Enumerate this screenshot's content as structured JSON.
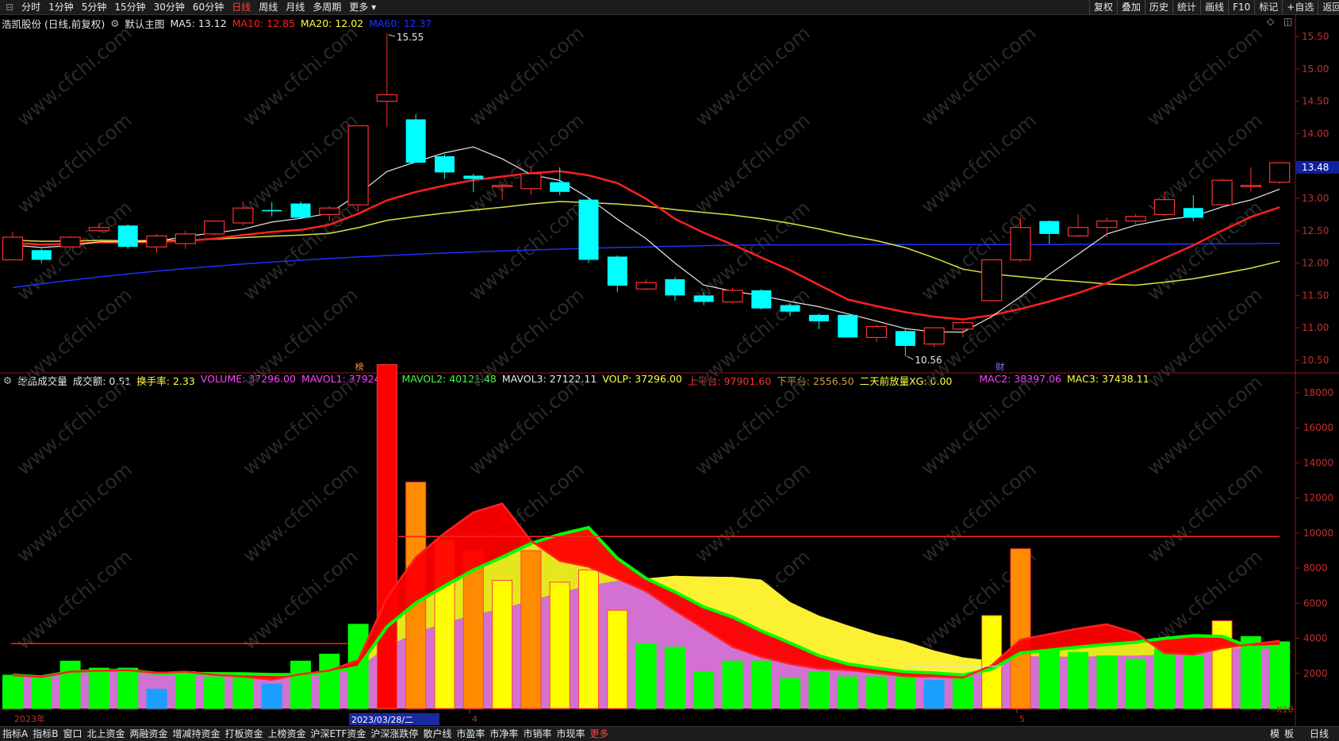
{
  "topbar": {
    "periods": [
      {
        "label": "分时",
        "active": false
      },
      {
        "label": "1分钟",
        "active": false
      },
      {
        "label": "5分钟",
        "active": false
      },
      {
        "label": "15分钟",
        "active": false
      },
      {
        "label": "30分钟",
        "active": false
      },
      {
        "label": "60分钟",
        "active": false
      },
      {
        "label": "日线",
        "active": true
      },
      {
        "label": "周线",
        "active": false
      },
      {
        "label": "月线",
        "active": false
      },
      {
        "label": "多周期",
        "active": false
      },
      {
        "label": "更多 ▾",
        "active": false
      }
    ],
    "right_buttons": [
      "复权",
      "叠加",
      "历史",
      "统计",
      "画线",
      "F10",
      "+自选",
      "返回"
    ],
    "mark_label": "标记"
  },
  "main_chart": {
    "stock_label": "浩凯股份 (日线,前复权)",
    "template_label": "默认主图",
    "ma": [
      {
        "text": "MA5: 13.12",
        "color": "#e8e8e8"
      },
      {
        "text": "MA10: 12.85",
        "color": "#ff2020"
      },
      {
        "text": "MA20: 12.02",
        "color": "#ffff40"
      },
      {
        "text": "MA60: 12.37",
        "color": "#2030ff"
      }
    ],
    "high_label": "15.55",
    "low_label": "10.56",
    "marker_bang": "榜",
    "marker_cai": "财",
    "price_axis": [
      "15.50",
      "15.00",
      "14.50",
      "14.00",
      "13.50",
      "13.00",
      "12.50",
      "12.00",
      "11.50",
      "11.00",
      "10.50"
    ],
    "current_price": "13.48"
  },
  "volume_chart": {
    "title": "绝品成交量",
    "items": [
      {
        "text": "成交额: 0.51",
        "color": "#e8e8e8"
      },
      {
        "text": "换手率: 2.33",
        "color": "#ffff40"
      },
      {
        "text": "VOLUME: 37296.00",
        "color": "#ff40ff"
      },
      {
        "text": "MAVOL1: 37924.60",
        "color": "#ff40ff"
      },
      {
        "text": "MAVOL2: 40121.48",
        "color": "#40ff40"
      },
      {
        "text": "MAVOL3: 27122.11",
        "color": "#e8e8e8"
      },
      {
        "text": "VOLP: 37296.00",
        "color": "#ffff40"
      },
      {
        "text": "上平台: 97901.60",
        "color": "#ff3030"
      },
      {
        "text": "下平台: 2556.50",
        "color": "#c8a040"
      },
      {
        "text": "二天前放量XG: 0.00",
        "color": "#ffff40"
      },
      {
        "text": "MAC2: 38397.06",
        "color": "#ff40ff"
      },
      {
        "text": "MAC3: 37438.11",
        "color": "#ffff40"
      }
    ],
    "axis": [
      "18000",
      "16000",
      "14000",
      "12000",
      "10000",
      "8000",
      "6000",
      "4000",
      "2000"
    ],
    "unit": "X10"
  },
  "date_axis": {
    "year": "2023年",
    "cursor_date": "2023/03/28/二",
    "m4": "4",
    "m5": "5"
  },
  "bottombar": {
    "tabs": [
      {
        "label": "指标A",
        "active": false
      },
      {
        "label": "指标B",
        "active": false
      },
      {
        "label": "窗口",
        "active": false
      },
      {
        "label": "北上资金",
        "active": false
      },
      {
        "label": "两融资金",
        "active": false
      },
      {
        "label": "增减持资金",
        "active": false
      },
      {
        "label": "打板资金",
        "active": false
      },
      {
        "label": "上榜资金",
        "active": false
      },
      {
        "label": "沪深ETF资金",
        "active": false
      },
      {
        "label": "沪深涨跌停",
        "active": false
      },
      {
        "label": "散户线",
        "active": false
      },
      {
        "label": "市盈率",
        "active": false
      },
      {
        "label": "市净率",
        "active": false
      },
      {
        "label": "市销率",
        "active": false
      },
      {
        "label": "市现率",
        "active": false
      },
      {
        "label": "更多",
        "active": true
      }
    ],
    "right": [
      "模",
      "板",
      "日线"
    ]
  },
  "candles": [
    {
      "o": 12.05,
      "c": 12.4,
      "h": 12.48,
      "l": 12.05
    },
    {
      "o": 12.2,
      "c": 12.05,
      "h": 12.22,
      "l": 12.0
    },
    {
      "o": 12.25,
      "c": 12.4,
      "h": 12.42,
      "l": 12.2
    },
    {
      "o": 12.5,
      "c": 12.55,
      "h": 12.62,
      "l": 12.48
    },
    {
      "o": 12.58,
      "c": 12.25,
      "h": 12.6,
      "l": 12.22
    },
    {
      "o": 12.25,
      "c": 12.42,
      "h": 12.45,
      "l": 12.15
    },
    {
      "o": 12.3,
      "c": 12.45,
      "h": 12.5,
      "l": 12.22
    },
    {
      "o": 12.45,
      "c": 12.65,
      "h": 12.66,
      "l": 12.42
    },
    {
      "o": 12.62,
      "c": 12.85,
      "h": 12.95,
      "l": 12.58
    },
    {
      "o": 12.82,
      "c": 12.8,
      "h": 12.94,
      "l": 12.72
    },
    {
      "o": 12.92,
      "c": 12.7,
      "h": 12.95,
      "l": 12.68
    },
    {
      "o": 12.75,
      "c": 12.85,
      "h": 12.88,
      "l": 12.65
    },
    {
      "o": 12.9,
      "c": 14.12,
      "h": 14.12,
      "l": 12.8
    },
    {
      "o": 14.5,
      "c": 14.6,
      "h": 15.55,
      "l": 14.1
    },
    {
      "o": 14.22,
      "c": 13.55,
      "h": 14.3,
      "l": 13.55
    },
    {
      "o": 13.65,
      "c": 13.4,
      "h": 13.68,
      "l": 13.3
    },
    {
      "o": 13.35,
      "c": 13.3,
      "h": 13.38,
      "l": 13.1
    },
    {
      "o": 13.18,
      "c": 13.2,
      "h": 13.22,
      "l": 12.98
    },
    {
      "o": 13.15,
      "c": 13.38,
      "h": 13.5,
      "l": 13.05
    },
    {
      "o": 13.25,
      "c": 13.1,
      "h": 13.48,
      "l": 13.05
    },
    {
      "o": 12.98,
      "c": 12.05,
      "h": 13.0,
      "l": 12.0
    },
    {
      "o": 12.1,
      "c": 11.65,
      "h": 12.12,
      "l": 11.55
    },
    {
      "o": 11.6,
      "c": 11.7,
      "h": 11.75,
      "l": 11.58
    },
    {
      "o": 11.75,
      "c": 11.5,
      "h": 11.78,
      "l": 11.42
    },
    {
      "o": 11.5,
      "c": 11.4,
      "h": 11.55,
      "l": 11.35
    },
    {
      "o": 11.4,
      "c": 11.58,
      "h": 11.62,
      "l": 11.38
    },
    {
      "o": 11.58,
      "c": 11.3,
      "h": 11.6,
      "l": 11.28
    },
    {
      "o": 11.35,
      "c": 11.25,
      "h": 11.38,
      "l": 11.18
    },
    {
      "o": 11.2,
      "c": 11.1,
      "h": 11.22,
      "l": 10.98
    },
    {
      "o": 11.2,
      "c": 10.85,
      "h": 11.2,
      "l": 10.85
    },
    {
      "o": 10.85,
      "c": 11.02,
      "h": 11.05,
      "l": 10.78
    },
    {
      "o": 10.95,
      "c": 10.72,
      "h": 11.0,
      "l": 10.56
    },
    {
      "o": 10.75,
      "c": 11.0,
      "h": 11.0,
      "l": 10.7
    },
    {
      "o": 10.98,
      "c": 11.08,
      "h": 11.1,
      "l": 10.85
    },
    {
      "o": 11.42,
      "c": 12.05,
      "h": 12.05,
      "l": 11.4
    },
    {
      "o": 12.05,
      "c": 12.55,
      "h": 12.7,
      "l": 12.02
    },
    {
      "o": 12.65,
      "c": 12.45,
      "h": 12.66,
      "l": 12.3
    },
    {
      "o": 12.42,
      "c": 12.55,
      "h": 12.75,
      "l": 12.4
    },
    {
      "o": 12.55,
      "c": 12.65,
      "h": 12.7,
      "l": 12.4
    },
    {
      "o": 12.65,
      "c": 12.72,
      "h": 12.76,
      "l": 12.58
    },
    {
      "o": 12.75,
      "c": 12.98,
      "h": 13.1,
      "l": 12.72
    },
    {
      "o": 12.85,
      "c": 12.7,
      "h": 13.05,
      "l": 12.65
    },
    {
      "o": 12.9,
      "c": 13.28,
      "h": 13.3,
      "l": 12.88
    },
    {
      "o": 13.18,
      "c": 13.2,
      "h": 13.48,
      "l": 13.1
    },
    {
      "o": 13.25,
      "c": 13.55,
      "h": 13.55,
      "l": 13.22
    }
  ],
  "volumes": [
    {
      "v": 1900,
      "c": "#00ff00"
    },
    {
      "v": 1700,
      "c": "#00ff00"
    },
    {
      "v": 2700,
      "c": "#00ff00"
    },
    {
      "v": 2300,
      "c": "#00ff00"
    },
    {
      "v": 2300,
      "c": "#00ff00"
    },
    {
      "v": 1100,
      "c": "#1a9fff"
    },
    {
      "v": 2100,
      "c": "#00ff00"
    },
    {
      "v": 1800,
      "c": "#00ff00"
    },
    {
      "v": 1800,
      "c": "#00ff00"
    },
    {
      "v": 1400,
      "c": "#1a9fff"
    },
    {
      "v": 2700,
      "c": "#00ff00"
    },
    {
      "v": 3100,
      "c": "#00ff00"
    },
    {
      "v": 4800,
      "c": "#00ff00"
    },
    {
      "v": 19600,
      "c": "#ff0000"
    },
    {
      "v": 12900,
      "c": "#ff8c00"
    },
    {
      "v": 9600,
      "c": "#ffff00"
    },
    {
      "v": 9000,
      "c": "#ff8c00"
    },
    {
      "v": 7300,
      "c": "#ffff00"
    },
    {
      "v": 9000,
      "c": "#ff8c00"
    },
    {
      "v": 7200,
      "c": "#ffff00"
    },
    {
      "v": 7900,
      "c": "#ffff00"
    },
    {
      "v": 5600,
      "c": "#ffff00"
    },
    {
      "v": 3700,
      "c": "#00ff00"
    },
    {
      "v": 3500,
      "c": "#00ff00"
    },
    {
      "v": 2100,
      "c": "#00ff00"
    },
    {
      "v": 2700,
      "c": "#00ff00"
    },
    {
      "v": 2700,
      "c": "#00ff00"
    },
    {
      "v": 1700,
      "c": "#00ff00"
    },
    {
      "v": 2100,
      "c": "#00ff00"
    },
    {
      "v": 1800,
      "c": "#00ff00"
    },
    {
      "v": 1800,
      "c": "#00ff00"
    },
    {
      "v": 1800,
      "c": "#00ff00"
    },
    {
      "v": 1600,
      "c": "#1a9fff"
    },
    {
      "v": 1800,
      "c": "#00ff00"
    },
    {
      "v": 5300,
      "c": "#ffff00"
    },
    {
      "v": 9100,
      "c": "#ff8c00"
    },
    {
      "v": 3400,
      "c": "#00ff00"
    },
    {
      "v": 3200,
      "c": "#00ff00"
    },
    {
      "v": 3000,
      "c": "#00ff00"
    },
    {
      "v": 2800,
      "c": "#00ff00"
    },
    {
      "v": 3400,
      "c": "#00ff00"
    },
    {
      "v": 3000,
      "c": "#00ff00"
    },
    {
      "v": 5000,
      "c": "#ffff00"
    },
    {
      "v": 4100,
      "c": "#00ff00"
    },
    {
      "v": 3800,
      "c": "#00ff00"
    }
  ]
}
